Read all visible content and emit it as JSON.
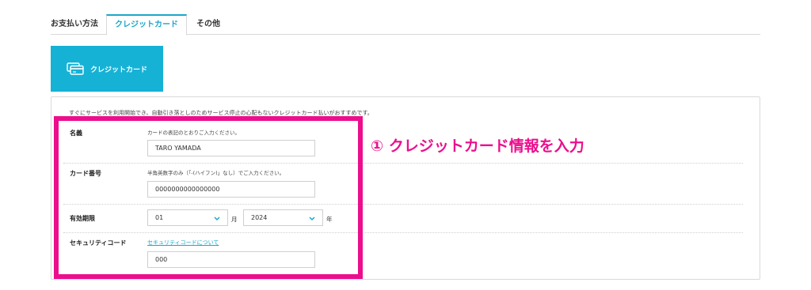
{
  "tabs": [
    {
      "label": "お支払い方法",
      "active": false
    },
    {
      "label": "クレジットカード",
      "active": true
    },
    {
      "label": "その他",
      "active": false
    }
  ],
  "method": {
    "label": "クレジットカード",
    "icon": "credit-card-icon"
  },
  "intro_text": "すぐにサービスを利用開始でき、自動引き落としのためサービス停止の心配もないクレジットカード払いがおすすめです。",
  "fields": {
    "name": {
      "label": "名義",
      "helper": "カードの表記のとおりご入力ください。",
      "value": "TARO YAMADA"
    },
    "card_number": {
      "label": "カード番号",
      "helper": "半角英数字のみ（「-(ハイフン)」なし）でご入力ください。",
      "value": "0000000000000000"
    },
    "expiry": {
      "label": "有効期限",
      "month": "01",
      "month_unit": "月",
      "year": "2024",
      "year_unit": "年"
    },
    "security_code": {
      "label": "セキュリティコード",
      "link": "セキュリティコードについて",
      "value": "000"
    }
  },
  "annotation": "① クレジットカード情報を入力",
  "colors": {
    "accent": "#16b2d6",
    "highlight": "#ec0e8d"
  }
}
